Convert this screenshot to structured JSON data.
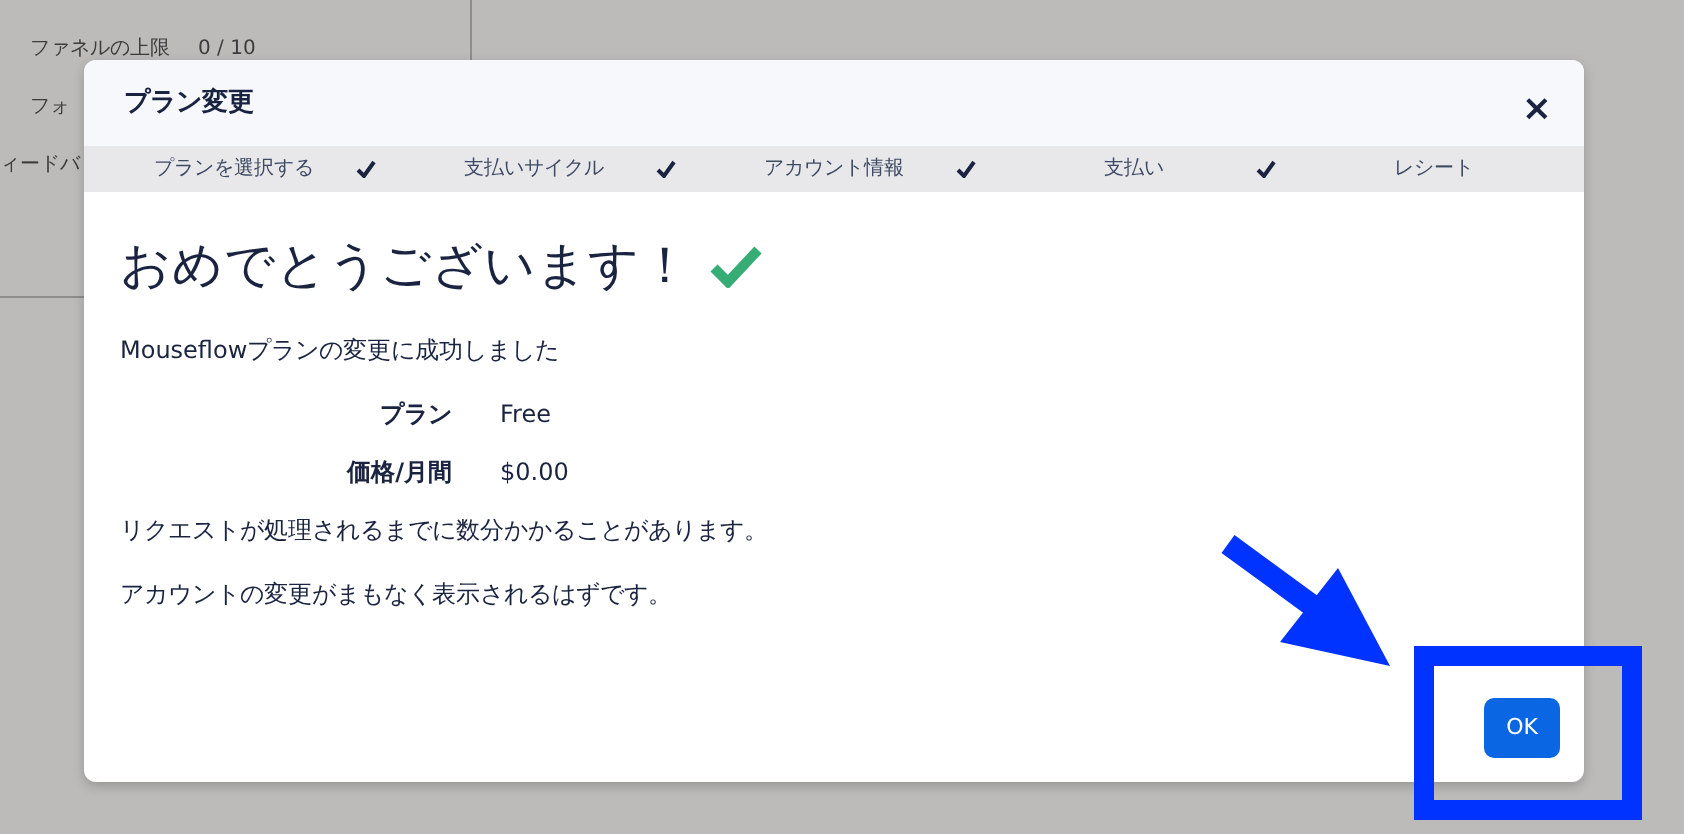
{
  "background": {
    "rows": [
      {
        "label": "ファネルの上限",
        "value": "0 / 10"
      },
      {
        "label": "フォ"
      },
      {
        "label": "ィードバ"
      }
    ]
  },
  "modal": {
    "title": "プラン変更",
    "close": "×",
    "steps": [
      {
        "label": "プランを選択する",
        "completed": true
      },
      {
        "label": "支払いサイクル",
        "completed": true
      },
      {
        "label": "アカウント情報",
        "completed": true
      },
      {
        "label": "支払い",
        "completed": true
      },
      {
        "label": "レシート",
        "completed": false
      }
    ],
    "heading": "おめでとうございます！",
    "message": "Mouseflowプランの変更に成功しました",
    "details": [
      {
        "label": "プラン",
        "value": "Free"
      },
      {
        "label": "価格/月間",
        "value": "$0.00"
      }
    ],
    "notes": [
      "リクエストが処理されるまでに数分かかることがあります。",
      "アカウントの変更がまもなく表示されるはずです。"
    ],
    "ok_button": "OK"
  }
}
